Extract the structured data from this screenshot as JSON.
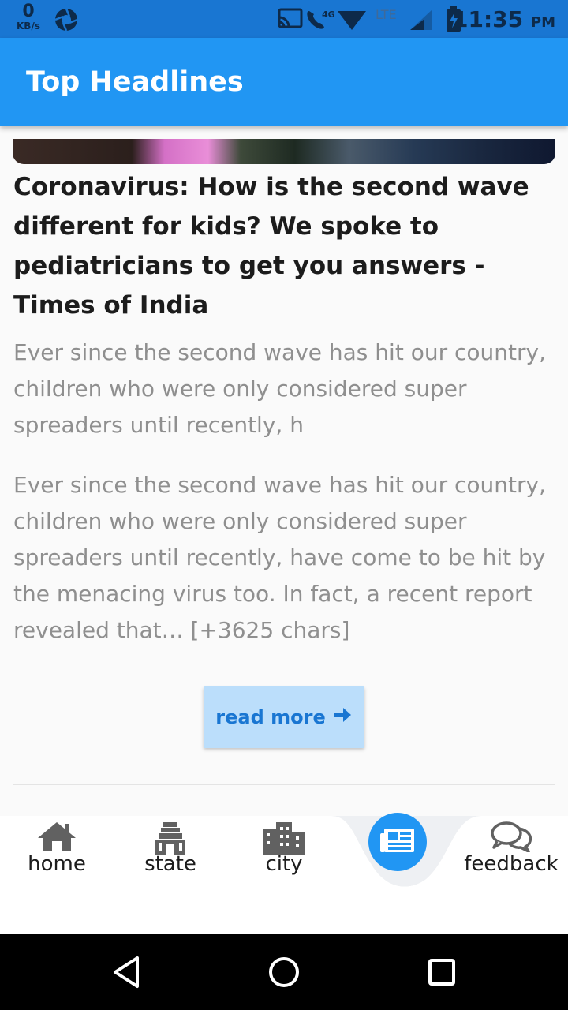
{
  "status_bar": {
    "speed_value": "0",
    "speed_unit": "KB/s",
    "network_label": "4G",
    "lte_label": "LTE",
    "time": "11:35",
    "ampm": "PM"
  },
  "app_bar": {
    "title": "Top Headlines"
  },
  "article": {
    "headline": "Coronavirus: How is the second wave different for kids? We spoke to pediatricians to get you answers - Times of India",
    "description": "Ever since the second wave has hit our country, children who were only considered super spreaders until recently, h",
    "content": "Ever since the second wave has hit our country, children who were only considered super spreaders until recently, have come to be hit by the menacing virus too. In fact, a recent report revealed that… [+3625 chars]",
    "read_more_label": "read more"
  },
  "bottom_nav": {
    "items": [
      {
        "label": "home",
        "icon": "home-icon"
      },
      {
        "label": "state",
        "icon": "temple-icon"
      },
      {
        "label": "city",
        "icon": "city-icon"
      },
      {
        "label": "",
        "icon": "newspaper-icon",
        "active": true
      },
      {
        "label": "feedback",
        "icon": "chat-bubbles-icon"
      }
    ]
  },
  "colors": {
    "primary": "#2196f3",
    "status_bar": "#1976d2",
    "button_bg": "#bbdefb",
    "button_text": "#1976d2"
  }
}
